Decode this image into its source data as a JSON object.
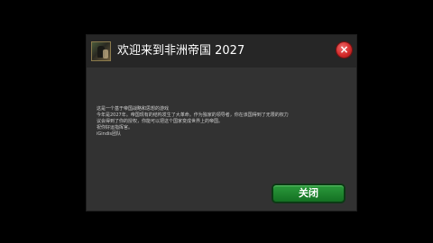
{
  "dialog": {
    "title": "欢迎来到非洲帝国 2027",
    "close_icon_glyph": "×",
    "body_lines": [
      "这是一个基于帝国战略和思想的游戏",
      "今年是2027年。帝国现有的结构发生了大革命。作为独家的领导者，你在该国得到了无限的权力",
      "议会得到了你的授权，你能可以把这个国家变成世界上的帝国。",
      "祝你好运指挥官。",
      "iGindis团队"
    ],
    "close_button_label": "关闭"
  },
  "colors": {
    "background": "#000000",
    "panel": "#323232",
    "header": "#262626",
    "close_icon": "#d42a2a",
    "button_green": "#1f8a30"
  }
}
